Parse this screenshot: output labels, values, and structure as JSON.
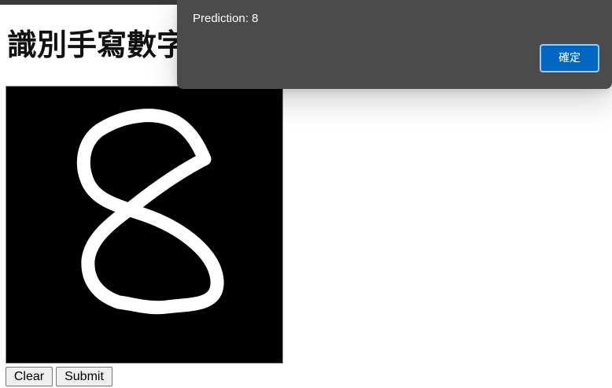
{
  "page": {
    "title": "識別手寫數字"
  },
  "canvas": {
    "background_color": "#000000",
    "stroke_color": "#ffffff",
    "drawn_digit": "8"
  },
  "controls": {
    "clear_label": "Clear",
    "submit_label": "Submit"
  },
  "alert": {
    "message": "Prediction: 8",
    "confirm_label": "確定",
    "background_color": "#4b4b4b",
    "button_color": "#0067c0"
  }
}
